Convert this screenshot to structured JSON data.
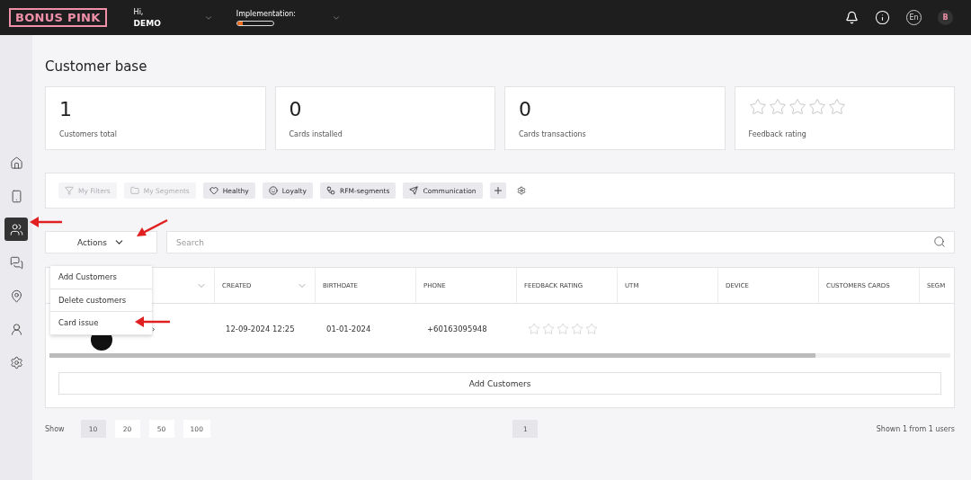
{
  "header": {
    "logo": "BONUS PINK",
    "greeting": "Hi,",
    "user": "DEMO",
    "implementation": {
      "label": "Implementation:",
      "level": 0.15
    },
    "language": "En",
    "avatar_letter": "B"
  },
  "sidebar": {
    "items": [
      {
        "selected": false
      },
      {
        "selected": false
      },
      {
        "selected": true
      },
      {
        "selected": false
      },
      {
        "selected": false
      },
      {
        "selected": false
      },
      {
        "selected": false
      }
    ]
  },
  "page_title": "Customer base",
  "stats": [
    {
      "kind": "number",
      "value": "1",
      "label": "Customers total"
    },
    {
      "kind": "number",
      "value": "0",
      "label": "Cards installed"
    },
    {
      "kind": "number",
      "value": "0",
      "label": "Cards transactions"
    },
    {
      "kind": "rating",
      "stars": 0,
      "label": "Feedback rating"
    }
  ],
  "filters": [
    {
      "label": "My Filters",
      "disabled": true
    },
    {
      "label": "My Segments",
      "disabled": true
    },
    {
      "label": "Healthy",
      "disabled": false
    },
    {
      "label": "Loyalty",
      "disabled": false
    },
    {
      "label": "RFM-segments",
      "disabled": false
    },
    {
      "label": "Communication",
      "disabled": false
    }
  ],
  "actions": {
    "label": "Actions",
    "expanded": true,
    "items": [
      "Add Customers",
      "Delete customers",
      "Card issue"
    ]
  },
  "search": {
    "placeholder": "Search"
  },
  "table": {
    "columns": [
      {
        "sortable": true
      },
      {
        "label": "CREATED",
        "sortable": true
      },
      {
        "label": "BIRTHDATE",
        "sortable": false
      },
      {
        "label": "PHONE",
        "sortable": false
      },
      {
        "label": "FEEDBACK RATING",
        "sortable": false
      },
      {
        "label": "UTM",
        "sortable": false
      },
      {
        "label": "DEVICE",
        "sortable": false
      },
      {
        "label": "CUSTOMERS CARDS",
        "sortable": false
      },
      {
        "label": "SEGM"
      }
    ],
    "rows": [
      {
        "name_mark": "›",
        "created": "12-09-2024 12:25",
        "birthdate": "01-01-2024",
        "phone": "+60163095948",
        "stars": 0
      }
    ]
  },
  "add_button": "Add Customers",
  "pagination": {
    "show_label": "Show",
    "sizes": [
      {
        "label": "10",
        "selected": true
      },
      {
        "label": "20",
        "selected": false
      },
      {
        "label": "50",
        "selected": false
      },
      {
        "label": "100",
        "selected": false
      }
    ],
    "pages": [
      {
        "label": "1",
        "selected": true
      }
    ],
    "summary": "Shown 1 from 1 users"
  }
}
